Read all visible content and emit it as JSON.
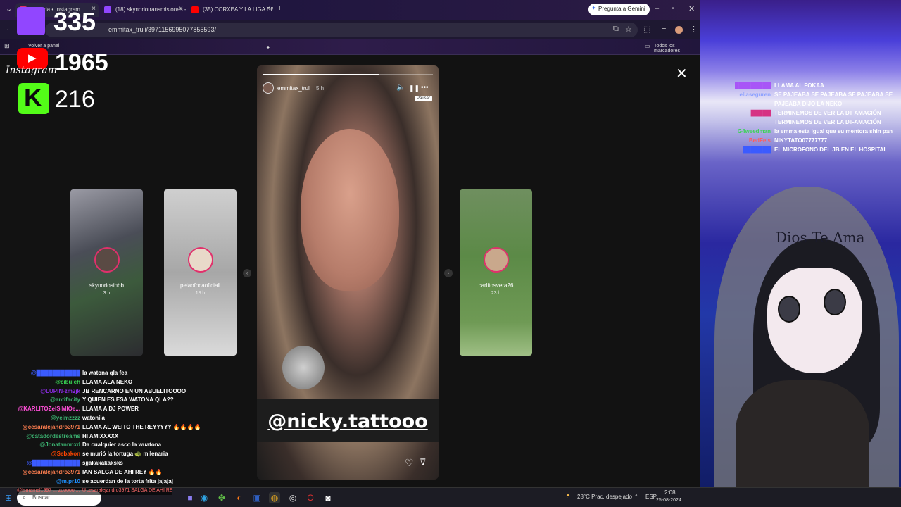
{
  "browser": {
    "tabs": [
      {
        "label": "Historia • Instagram",
        "fav": "#e1306c"
      },
      {
        "label": "(18) skynoriotransmisiones - Tw",
        "fav": "#9146ff"
      },
      {
        "label": "(35) CORXEA Y LA LIGA DE",
        "fav": "#ff0000"
      }
    ],
    "gemini_label": "Pregunta a Gemini",
    "url": "emmitax_truli/3971156995077855593/",
    "bookmark_panel": "Volver a panel",
    "bookmarks_all": "Todos los marcadores"
  },
  "overlay": {
    "twitch_count": "335",
    "youtube_count": "1965",
    "instagram_label": "Instagram",
    "kick_count": "216"
  },
  "story": {
    "username": "emmitax_truli",
    "time": "5 h",
    "pause_tooltip": "Pausar",
    "sticker": "@nicky.tattooo",
    "progress": 0.68
  },
  "side_stories": [
    {
      "name": "skynoriosinbb",
      "time": "3 h"
    },
    {
      "name": "pelaofocaoficiall",
      "time": "18 h"
    },
    {
      "name": "carlitosvera26",
      "time": "23 h"
    }
  ],
  "chat_left": [
    {
      "name": "@███████████",
      "color": "#3b5bff",
      "msg": "la watona qla fea"
    },
    {
      "name": "@cibuleh",
      "color": "#39d353",
      "msg": "LLAMA ALA NEKO"
    },
    {
      "name": "@LUPIN-zm2jk",
      "color": "#8a2be2",
      "msg": "JB RENCARNO EN UN ABUELITOOOO"
    },
    {
      "name": "@antifacity",
      "color": "#3cb371",
      "msg": "Y QUIEN ES ESA WATONA QLA??"
    },
    {
      "name": "@KARLITOZelSIMIOe...",
      "color": "#ff4fd8",
      "msg": "LLAMA A DJ POWER"
    },
    {
      "name": "@yeimzzzz",
      "color": "#3cb371",
      "msg": "watonila"
    },
    {
      "name": "@cesaralejandro3971",
      "color": "#ff7f50",
      "msg": "LLAMA AL WEITO THE REYYYYY 🔥🔥🔥🔥"
    },
    {
      "name": "@catadordestreams",
      "color": "#3cb371",
      "msg": "HI AMIXXXXX"
    },
    {
      "name": "@Jonatannnxd",
      "color": "#3cb371",
      "msg": "Da cualquier asco la wuatona"
    },
    {
      "name": "@Sebakon",
      "color": "#ff4500",
      "msg": "se murió la tortuga 🐢 milenaria"
    },
    {
      "name": "@████████████",
      "color": "#3b5bff",
      "msg": "sjjakakakaksks"
    },
    {
      "name": "@cesaralejandro3971",
      "color": "#ff7f50",
      "msg": "IAN SALGA DE AHI REY 🔥🔥"
    },
    {
      "name": "@m.pr10",
      "color": "#1e90ff",
      "msg": "se acuerdan de la torta frita jajajaj"
    }
  ],
  "chat_right": [
    {
      "name": "█████████",
      "color": "#a855f7",
      "msg": "LLAMA AL FOKAA",
      "cont": ""
    },
    {
      "name": "eliaseguren",
      "color": "#8ea2ff",
      "msg": "SE PAJEABA SE PAJEABA SE PAJEABA SE",
      "cont": "PAJEABA DIJO LA NEKO"
    },
    {
      "name": "█████",
      "color": "#d63384",
      "msg": "TERMINEMOS DE VER LA DIFAMACIÓN",
      "cont": "TERMINEMOS DE VER LA DIFAMACIÓN"
    },
    {
      "name": "G4weedman",
      "color": "#39d353",
      "msg": "la emma esta igual que su mentora shin pan",
      "cont": ""
    },
    {
      "name": "BedFeis",
      "color": "#ff5c5c",
      "msg": "NIKYTATO07777777",
      "cont": ""
    },
    {
      "name": "███████",
      "color": "#3b5bff",
      "msg": "EL MICROFONO DEL JB EN EL HOSPITAL",
      "cont": ""
    }
  ],
  "vtuber_text": "Dios Te Ama",
  "taskbar": {
    "search_placeholder": "Buscar",
    "ticker": "@Ismamel1997 ... zooooo ... @cesaralejandro3971 SALGA DE AHI REY",
    "weather": "28°C  Prac. despejado",
    "lang": "ESP",
    "time": "2:08",
    "date": "25-08-2024"
  }
}
